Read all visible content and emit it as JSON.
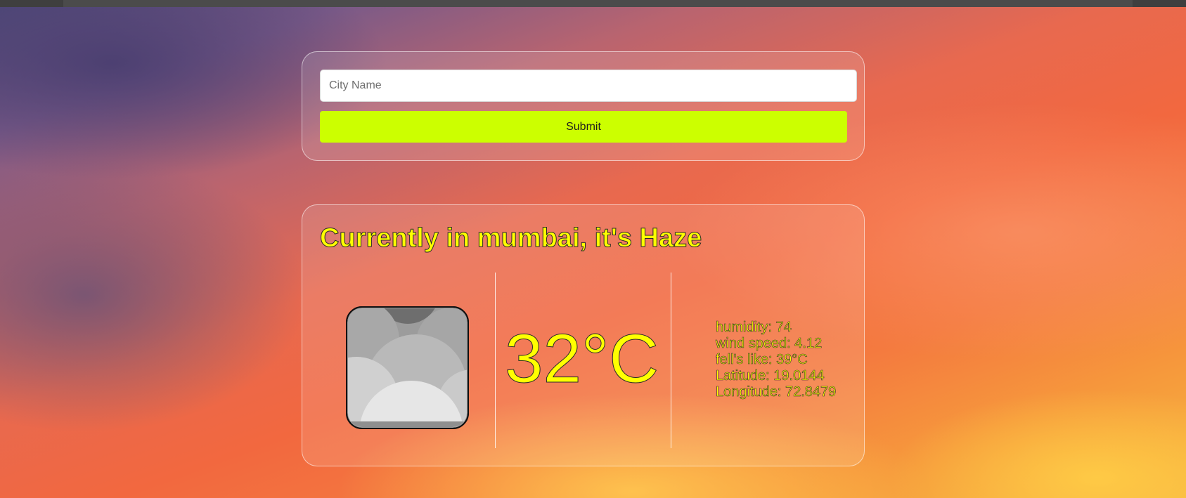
{
  "search": {
    "input_value": "",
    "placeholder": "City Name",
    "submit_label": "Submit"
  },
  "weather": {
    "heading": "Currently in mumbai, it's Haze",
    "icon": "haze-clouds-icon",
    "temperature": "32°C",
    "details": {
      "humidity": "humidity: 74",
      "wind_speed": "wind speed: 4.12",
      "feels_like": "fell's like: 39°C",
      "latitude": "Latitude: 19.0144",
      "longitude": "Longitude: 72.8479"
    }
  },
  "colors": {
    "accent_button": "#ccff00",
    "text_yellow": "#ffff00",
    "text_outline": "#2a2a2a"
  }
}
